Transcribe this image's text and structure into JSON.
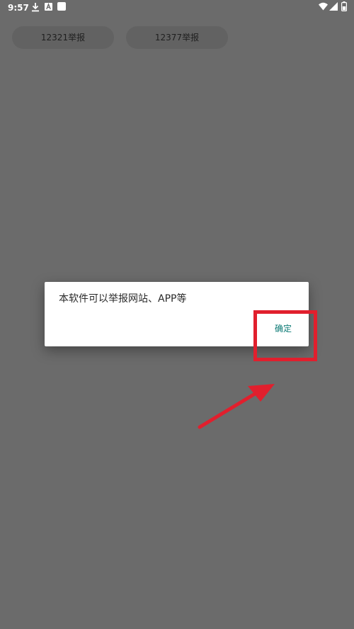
{
  "status_bar": {
    "time": "9:57",
    "icons": [
      "download-icon",
      "a-notification-icon",
      "app-square-icon",
      "wifi-icon",
      "signal-icon",
      "battery-icon"
    ]
  },
  "top_buttons": {
    "btn1_label": "12321举报",
    "btn2_label": "12377举报"
  },
  "dialog": {
    "message": "本软件可以举报网站、APP等",
    "ok_label": "确定"
  },
  "colors": {
    "scrim": "#6b6b6b",
    "dialog_bg": "#ffffff",
    "accent": "#0c7a75",
    "annotation": "#e11f2d"
  }
}
